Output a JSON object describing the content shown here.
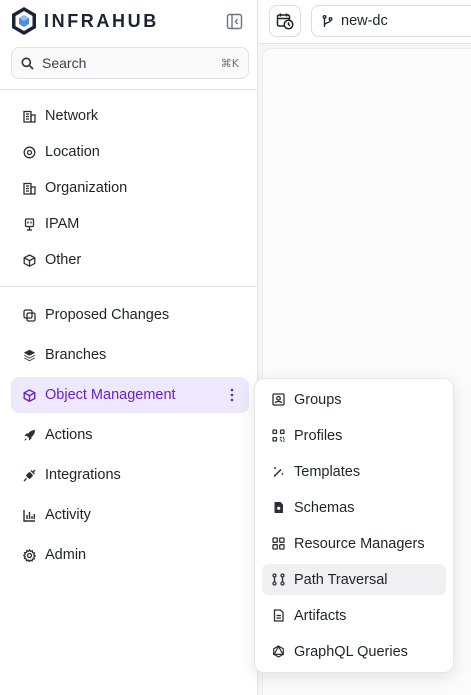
{
  "app": {
    "brand": "INFRAHUB"
  },
  "search": {
    "label": "Search",
    "shortcut": "⌘K"
  },
  "nav_primary": [
    {
      "label": "Network",
      "icon": "building-icon"
    },
    {
      "label": "Location",
      "icon": "map-pin-icon"
    },
    {
      "label": "Organization",
      "icon": "building-icon"
    },
    {
      "label": "IPAM",
      "icon": "ethernet-icon"
    },
    {
      "label": "Other",
      "icon": "cube-icon"
    }
  ],
  "nav_secondary": [
    {
      "label": "Proposed Changes",
      "icon": "copy-icon"
    },
    {
      "label": "Branches",
      "icon": "layers-icon"
    },
    {
      "label": "Object Management",
      "icon": "cube-icon",
      "active": true
    },
    {
      "label": "Actions",
      "icon": "rocket-icon"
    },
    {
      "label": "Integrations",
      "icon": "plug-icon"
    },
    {
      "label": "Activity",
      "icon": "bar-chart-icon"
    },
    {
      "label": "Admin",
      "icon": "gear-icon"
    }
  ],
  "topbar": {
    "branch": "new-dc",
    "branch_icon": "git-branch-icon",
    "date_icon": "calendar-clock-icon"
  },
  "object_menu": [
    {
      "label": "Groups",
      "icon": "group-icon"
    },
    {
      "label": "Profiles",
      "icon": "profiles-icon"
    },
    {
      "label": "Templates",
      "icon": "magic-wand-icon"
    },
    {
      "label": "Schemas",
      "icon": "schema-file-icon"
    },
    {
      "label": "Resource Managers",
      "icon": "grid-icon"
    },
    {
      "label": "Path Traversal",
      "icon": "path-icon",
      "hovered": true
    },
    {
      "label": "Artifacts",
      "icon": "document-icon"
    },
    {
      "label": "GraphQL Queries",
      "icon": "graphql-icon"
    }
  ],
  "colors": {
    "accent": "#6b21c8",
    "active_bg": "#ede8fb",
    "brand_dark": "#1b2433"
  }
}
